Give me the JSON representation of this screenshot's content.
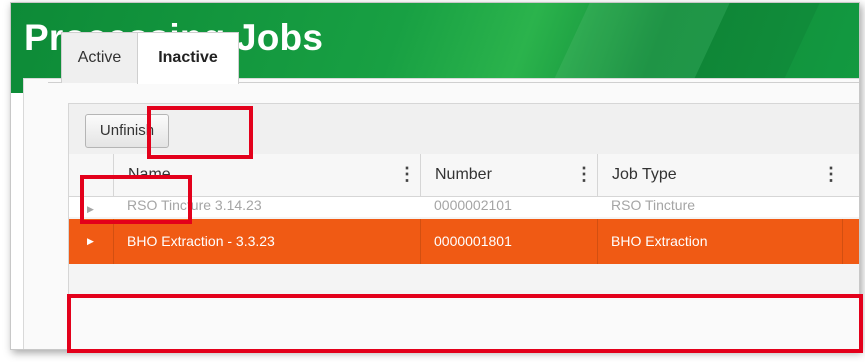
{
  "page": {
    "title": "Processing Jobs"
  },
  "tabs": [
    {
      "label": "Active"
    },
    {
      "label": "Inactive"
    }
  ],
  "toolbar": {
    "unfinish_label": "Unfinish"
  },
  "grid": {
    "columns": [
      {
        "label": "Name"
      },
      {
        "label": "Number"
      },
      {
        "label": "Job Type"
      }
    ],
    "rows": [
      {
        "name": "RSO Tincture 3.14.23",
        "number": "0000002101",
        "job_type": "RSO Tincture"
      },
      {
        "name": "BHO Extraction - 3.3.23",
        "number": "0000001801",
        "job_type": "BHO Extraction"
      }
    ]
  },
  "colors": {
    "header_green": "#18a043",
    "selected_row": "#f05a14",
    "highlight_red": "#e3001b"
  },
  "icons": {
    "column_menu": "kebab-menu-icon",
    "row_expander": "caret-right-icon"
  }
}
